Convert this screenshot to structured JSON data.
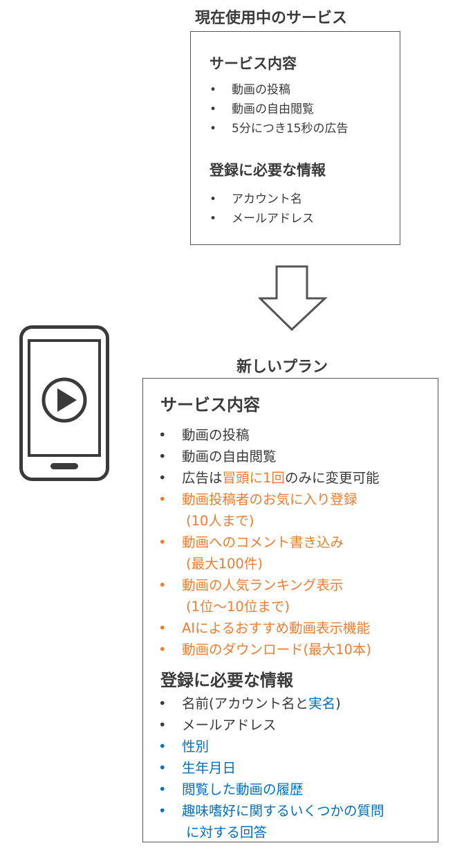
{
  "current": {
    "title": "現在使用中のサービス",
    "service_heading": "サービス内容",
    "service_items": [
      "動画の投稿",
      "動画の自由閲覧",
      "5分につき15秒の広告"
    ],
    "registration_heading": "登録に必要な情報",
    "registration_items": [
      "アカウント名",
      "メールアドレス"
    ]
  },
  "new_plan": {
    "title": "新しいプラン",
    "service_heading": "サービス内容",
    "service_items": [
      [
        {
          "text": "動画の投稿",
          "color": "default"
        }
      ],
      [
        {
          "text": "動画の自由閲覧",
          "color": "default"
        }
      ],
      [
        {
          "text": "広告は",
          "color": "default"
        },
        {
          "text": "冒頭に1回",
          "color": "orange"
        },
        {
          "text": "のみに変更可能",
          "color": "default"
        }
      ],
      [
        {
          "text": "動画投稿者のお気に入り登録",
          "color": "orange"
        }
      ],
      [
        {
          "text": "(10人まで)",
          "color": "orange",
          "continuation": true
        }
      ],
      [
        {
          "text": "動画へのコメント書き込み",
          "color": "orange"
        }
      ],
      [
        {
          "text": "(最大100件)",
          "color": "orange",
          "continuation": true
        }
      ],
      [
        {
          "text": "動画の人気ランキング表示",
          "color": "orange"
        }
      ],
      [
        {
          "text": "(1位～10位まで)",
          "color": "orange",
          "continuation": true
        }
      ],
      [
        {
          "text": "AIによるおすすめ動画表示機能",
          "color": "orange"
        }
      ],
      [
        {
          "text": "動画のダウンロード(最大10本)",
          "color": "orange"
        }
      ]
    ],
    "registration_heading": "登録に必要な情報",
    "registration_items": [
      [
        {
          "text": "名前(アカウント名と",
          "color": "default"
        },
        {
          "text": "実名",
          "color": "blue"
        },
        {
          "text": ")",
          "color": "default"
        }
      ],
      [
        {
          "text": "メールアドレス",
          "color": "default"
        }
      ],
      [
        {
          "text": "性別",
          "color": "blue"
        }
      ],
      [
        {
          "text": "生年月日",
          "color": "blue"
        }
      ],
      [
        {
          "text": "閲覧した動画の履歴",
          "color": "blue"
        }
      ],
      [
        {
          "text": "趣味嗜好に関するいくつかの質問",
          "color": "blue"
        }
      ],
      [
        {
          "text": "に対する回答",
          "color": "blue",
          "continuation": true
        }
      ]
    ]
  },
  "bullet": "•",
  "icons": {
    "arrow": "down-arrow-icon",
    "phone": "smartphone-play-icon"
  },
  "colors": {
    "text": "#3a3a3a",
    "orange": "#ed7d31",
    "blue": "#0070c0",
    "border": "#555555"
  }
}
